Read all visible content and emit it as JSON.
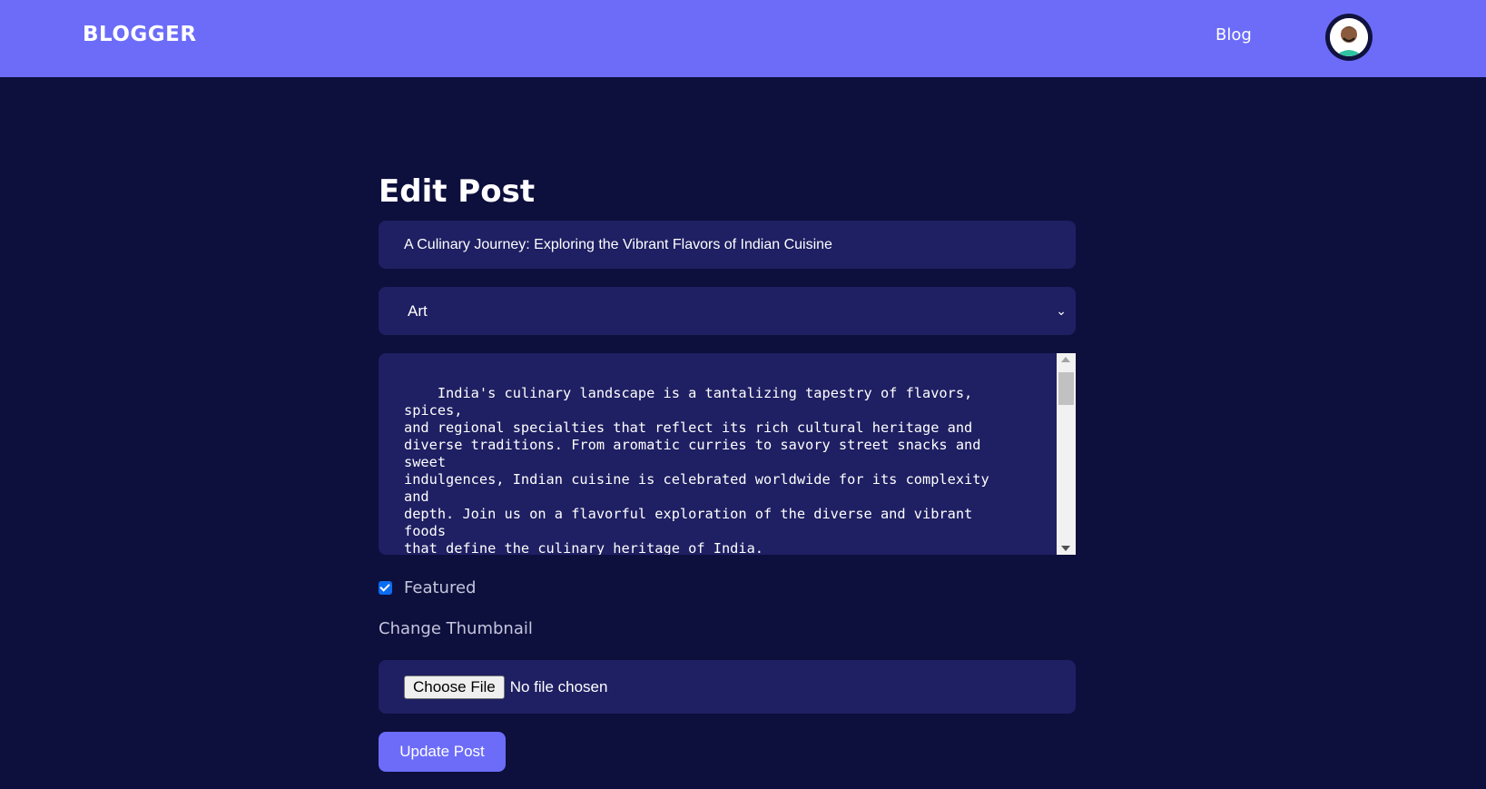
{
  "navbar": {
    "logo": "BLOGGER",
    "links": [
      {
        "label": "Blog"
      }
    ],
    "colors": {
      "background": "#6c6cf9"
    }
  },
  "form": {
    "heading": "Edit Post",
    "title_value": "A Culinary Journey: Exploring the Vibrant Flavors of Indian Cuisine",
    "category_value": "Art",
    "body_value": "India's culinary landscape is a tantalizing tapestry of flavors, spices,\nand regional specialties that reflect its rich cultural heritage and\ndiverse traditions. From aromatic curries to savory street snacks and sweet\nindulgences, Indian cuisine is celebrated worldwide for its complexity and\ndepth. Join us on a flavorful exploration of the diverse and vibrant foods\nthat define the culinary heritage of India.\n\nA Tapestry of Regional Diversity\nIndian cuisine is as diverse as its landscape, with each region boasting\nits own unique culinary traditions and specialties. From the fiery dishes\nof the South to the rich Mughlai delicacies of the North, and the coastal",
    "featured_label": "Featured",
    "featured_checked": true,
    "thumbnail_label": "Change Thumbnail",
    "file_button_label": "Choose File",
    "file_status": "No file chosen",
    "submit_label": "Update Post"
  },
  "colors": {
    "page_background": "#0d0f3d",
    "field_background": "#1f1f63",
    "accent": "#6c6cf9"
  }
}
